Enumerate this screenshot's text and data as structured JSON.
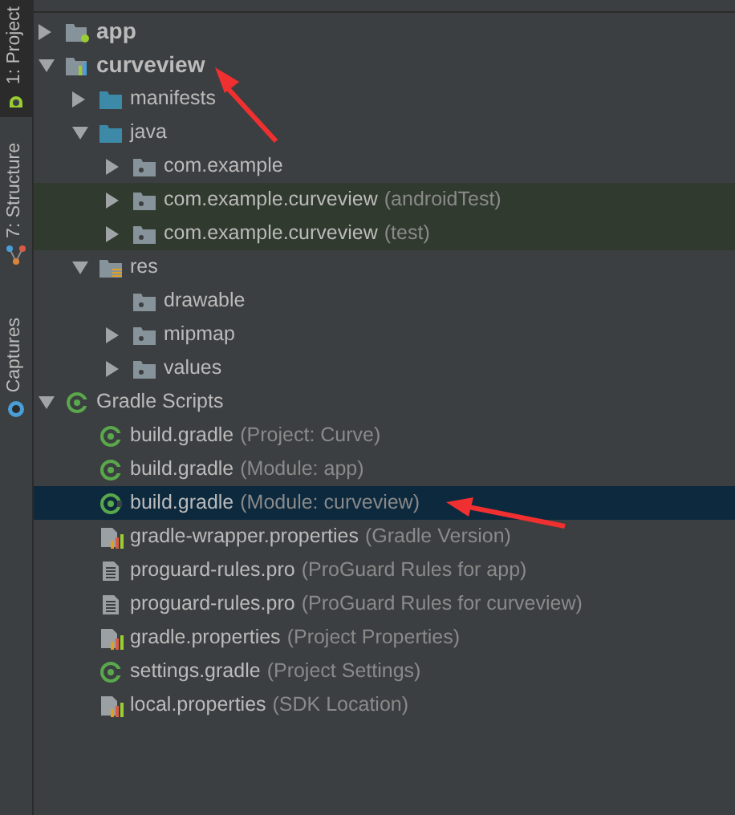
{
  "tool_tabs": [
    {
      "label": "1: Project",
      "selected": true,
      "kind": "project"
    },
    {
      "label": "7: Structure",
      "selected": false,
      "kind": "structure"
    },
    {
      "label": "Captures",
      "selected": false,
      "kind": "captures"
    }
  ],
  "tree": [
    {
      "kind": "app-module",
      "label": "app",
      "expanded": false,
      "selected": false,
      "highlighted": false
    },
    {
      "kind": "lib-module",
      "label": "curveview",
      "expanded": true,
      "selected": false,
      "highlighted": false,
      "children": [
        {
          "kind": "folder",
          "label": "manifests",
          "expanded": false,
          "selected": false,
          "highlighted": false
        },
        {
          "kind": "folder",
          "label": "java",
          "expanded": true,
          "selected": false,
          "highlighted": false,
          "children": [
            {
              "kind": "package",
              "label": "com.example",
              "expanded": false,
              "selected": false,
              "highlighted": false
            },
            {
              "kind": "package",
              "label": "com.example.curveview",
              "note": "(androidTest)",
              "expanded": false,
              "selected": false,
              "highlighted": true
            },
            {
              "kind": "package",
              "label": "com.example.curveview",
              "note": "(test)",
              "expanded": false,
              "selected": false,
              "highlighted": true
            }
          ]
        },
        {
          "kind": "res",
          "label": "res",
          "expanded": true,
          "selected": false,
          "highlighted": false,
          "children": [
            {
              "kind": "package",
              "label": "drawable",
              "selected": false,
              "highlighted": false
            },
            {
              "kind": "package",
              "label": "mipmap",
              "expanded": false,
              "selected": false,
              "highlighted": false
            },
            {
              "kind": "package",
              "label": "values",
              "expanded": false,
              "selected": false,
              "highlighted": false
            }
          ]
        }
      ]
    },
    {
      "kind": "gradle",
      "label": "Gradle Scripts",
      "expanded": true,
      "selected": false,
      "highlighted": false,
      "children": [
        {
          "kind": "gradle",
          "label": "build.gradle",
          "note": "(Project: Curve)",
          "selected": false,
          "highlighted": false
        },
        {
          "kind": "gradle",
          "label": "build.gradle",
          "note": "(Module: app)",
          "selected": false,
          "highlighted": false
        },
        {
          "kind": "gradle",
          "label": "build.gradle",
          "note": "(Module: curveview)",
          "selected": true,
          "highlighted": false
        },
        {
          "kind": "properties",
          "label": "gradle-wrapper.properties",
          "note": "(Gradle Version)",
          "selected": false,
          "highlighted": false
        },
        {
          "kind": "text",
          "label": "proguard-rules.pro",
          "note": "(ProGuard Rules for app)",
          "selected": false,
          "highlighted": false
        },
        {
          "kind": "text",
          "label": "proguard-rules.pro",
          "note": "(ProGuard Rules for curveview)",
          "selected": false,
          "highlighted": false
        },
        {
          "kind": "properties",
          "label": "gradle.properties",
          "note": "(Project Properties)",
          "selected": false,
          "highlighted": false
        },
        {
          "kind": "gradle",
          "label": "settings.gradle",
          "note": "(Project Settings)",
          "selected": false,
          "highlighted": false
        },
        {
          "kind": "properties",
          "label": "local.properties",
          "note": "(SDK Location)",
          "selected": false,
          "highlighted": false
        }
      ]
    }
  ]
}
